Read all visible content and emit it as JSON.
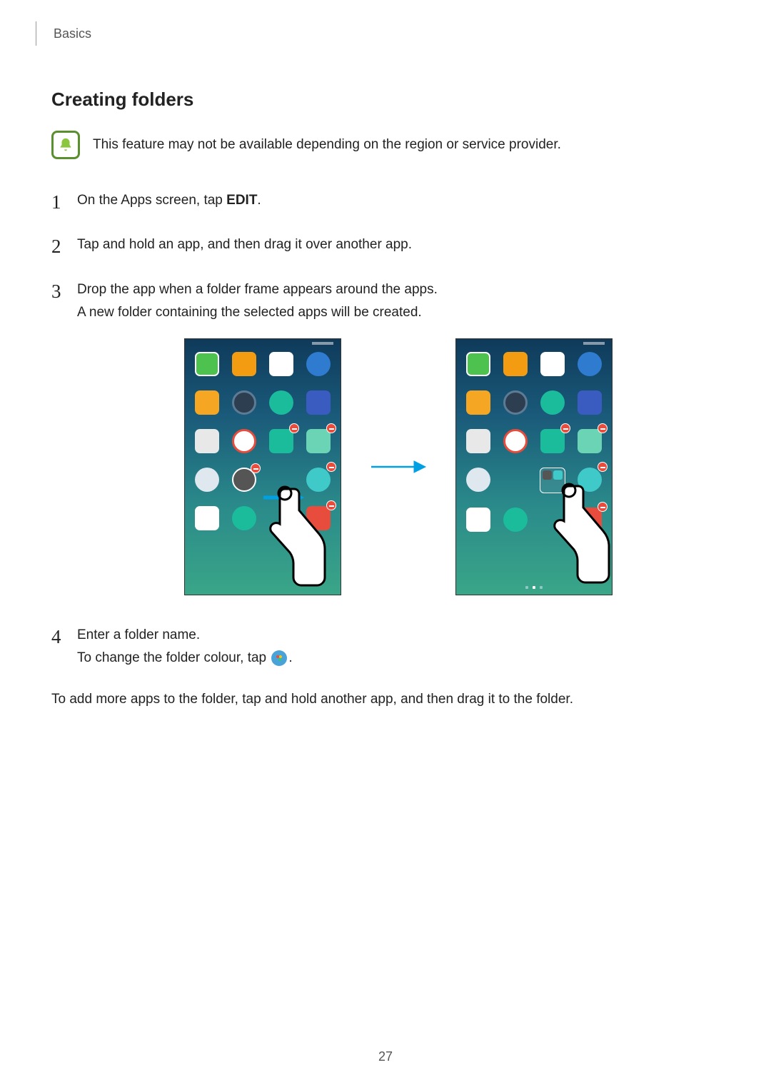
{
  "header": {
    "section": "Basics"
  },
  "title": "Creating folders",
  "notice": {
    "text": "This feature may not be available depending on the region or service provider."
  },
  "steps": {
    "s1": {
      "pre": "On the Apps screen, tap ",
      "bold": "EDIT",
      "post": "."
    },
    "s2": "Tap and hold an app, and then drag it over another app.",
    "s3a": "Drop the app when a folder frame appears around the apps.",
    "s3b": "A new folder containing the selected apps will be created.",
    "s4a": "Enter a folder name.",
    "s4b_pre": "To change the folder colour, tap ",
    "s4b_post": "."
  },
  "footer_para": "To add more apps to the folder, tap and hold another app, and then drag it to the folder.",
  "page_number": "27"
}
